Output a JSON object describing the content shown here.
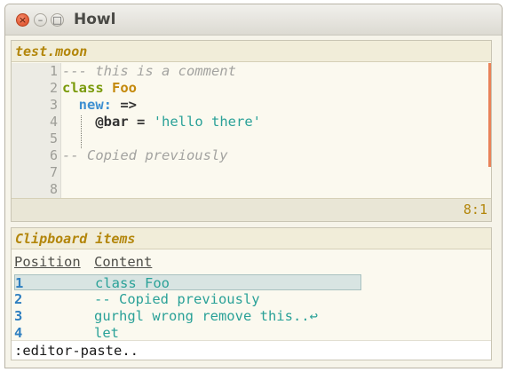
{
  "window": {
    "title": "Howl",
    "close_glyph": "×",
    "min_glyph": "–",
    "max_glyph": "□"
  },
  "editor": {
    "filename": "test.moon",
    "lines": [
      {
        "num": "1",
        "tokens": [
          {
            "t": "--- this is a comment",
            "k": "comment"
          }
        ]
      },
      {
        "num": "2",
        "tokens": [
          {
            "t": "class",
            "k": "kw"
          },
          {
            "t": " ",
            "k": "plain"
          },
          {
            "t": "Foo",
            "k": "cls"
          }
        ]
      },
      {
        "num": "3",
        "tokens": [
          {
            "t": "  ",
            "k": "plain"
          },
          {
            "t": "new:",
            "k": "key"
          },
          {
            "t": " ",
            "k": "plain"
          },
          {
            "t": "=>",
            "k": "op"
          }
        ]
      },
      {
        "num": "4",
        "tokens": [
          {
            "t": "    ",
            "k": "plain"
          },
          {
            "t": "@bar",
            "k": "ivar"
          },
          {
            "t": " ",
            "k": "plain"
          },
          {
            "t": "=",
            "k": "op"
          },
          {
            "t": " ",
            "k": "plain"
          },
          {
            "t": "'hello there'",
            "k": "str"
          }
        ]
      },
      {
        "num": "5",
        "tokens": []
      },
      {
        "num": "6",
        "tokens": [
          {
            "t": "-- Copied previously",
            "k": "comment"
          }
        ]
      },
      {
        "num": "7",
        "tokens": []
      },
      {
        "num": "8",
        "tokens": []
      }
    ],
    "cursor_position": "8:1"
  },
  "clipboard": {
    "title": "Clipboard items",
    "columns": {
      "position": "Position",
      "content": "Content"
    },
    "items": [
      {
        "pos": "1",
        "content": "class Foo",
        "selected": true
      },
      {
        "pos": "2",
        "content": "-- Copied previously",
        "selected": false
      },
      {
        "pos": "3",
        "content": "gurhgl wrong remove this..↩",
        "selected": false
      },
      {
        "pos": "4",
        "content": "let",
        "selected": false
      }
    ],
    "command": ":editor-paste.."
  },
  "colors": {
    "accent_header": "#b3860b",
    "comment": "#a3a3a0",
    "keyword": "#7a9a0a",
    "class_name": "#c4890c",
    "key": "#3d8fd1",
    "string": "#2aa198",
    "index": "#2f7fc0",
    "scroll_marker": "#e9835a"
  }
}
